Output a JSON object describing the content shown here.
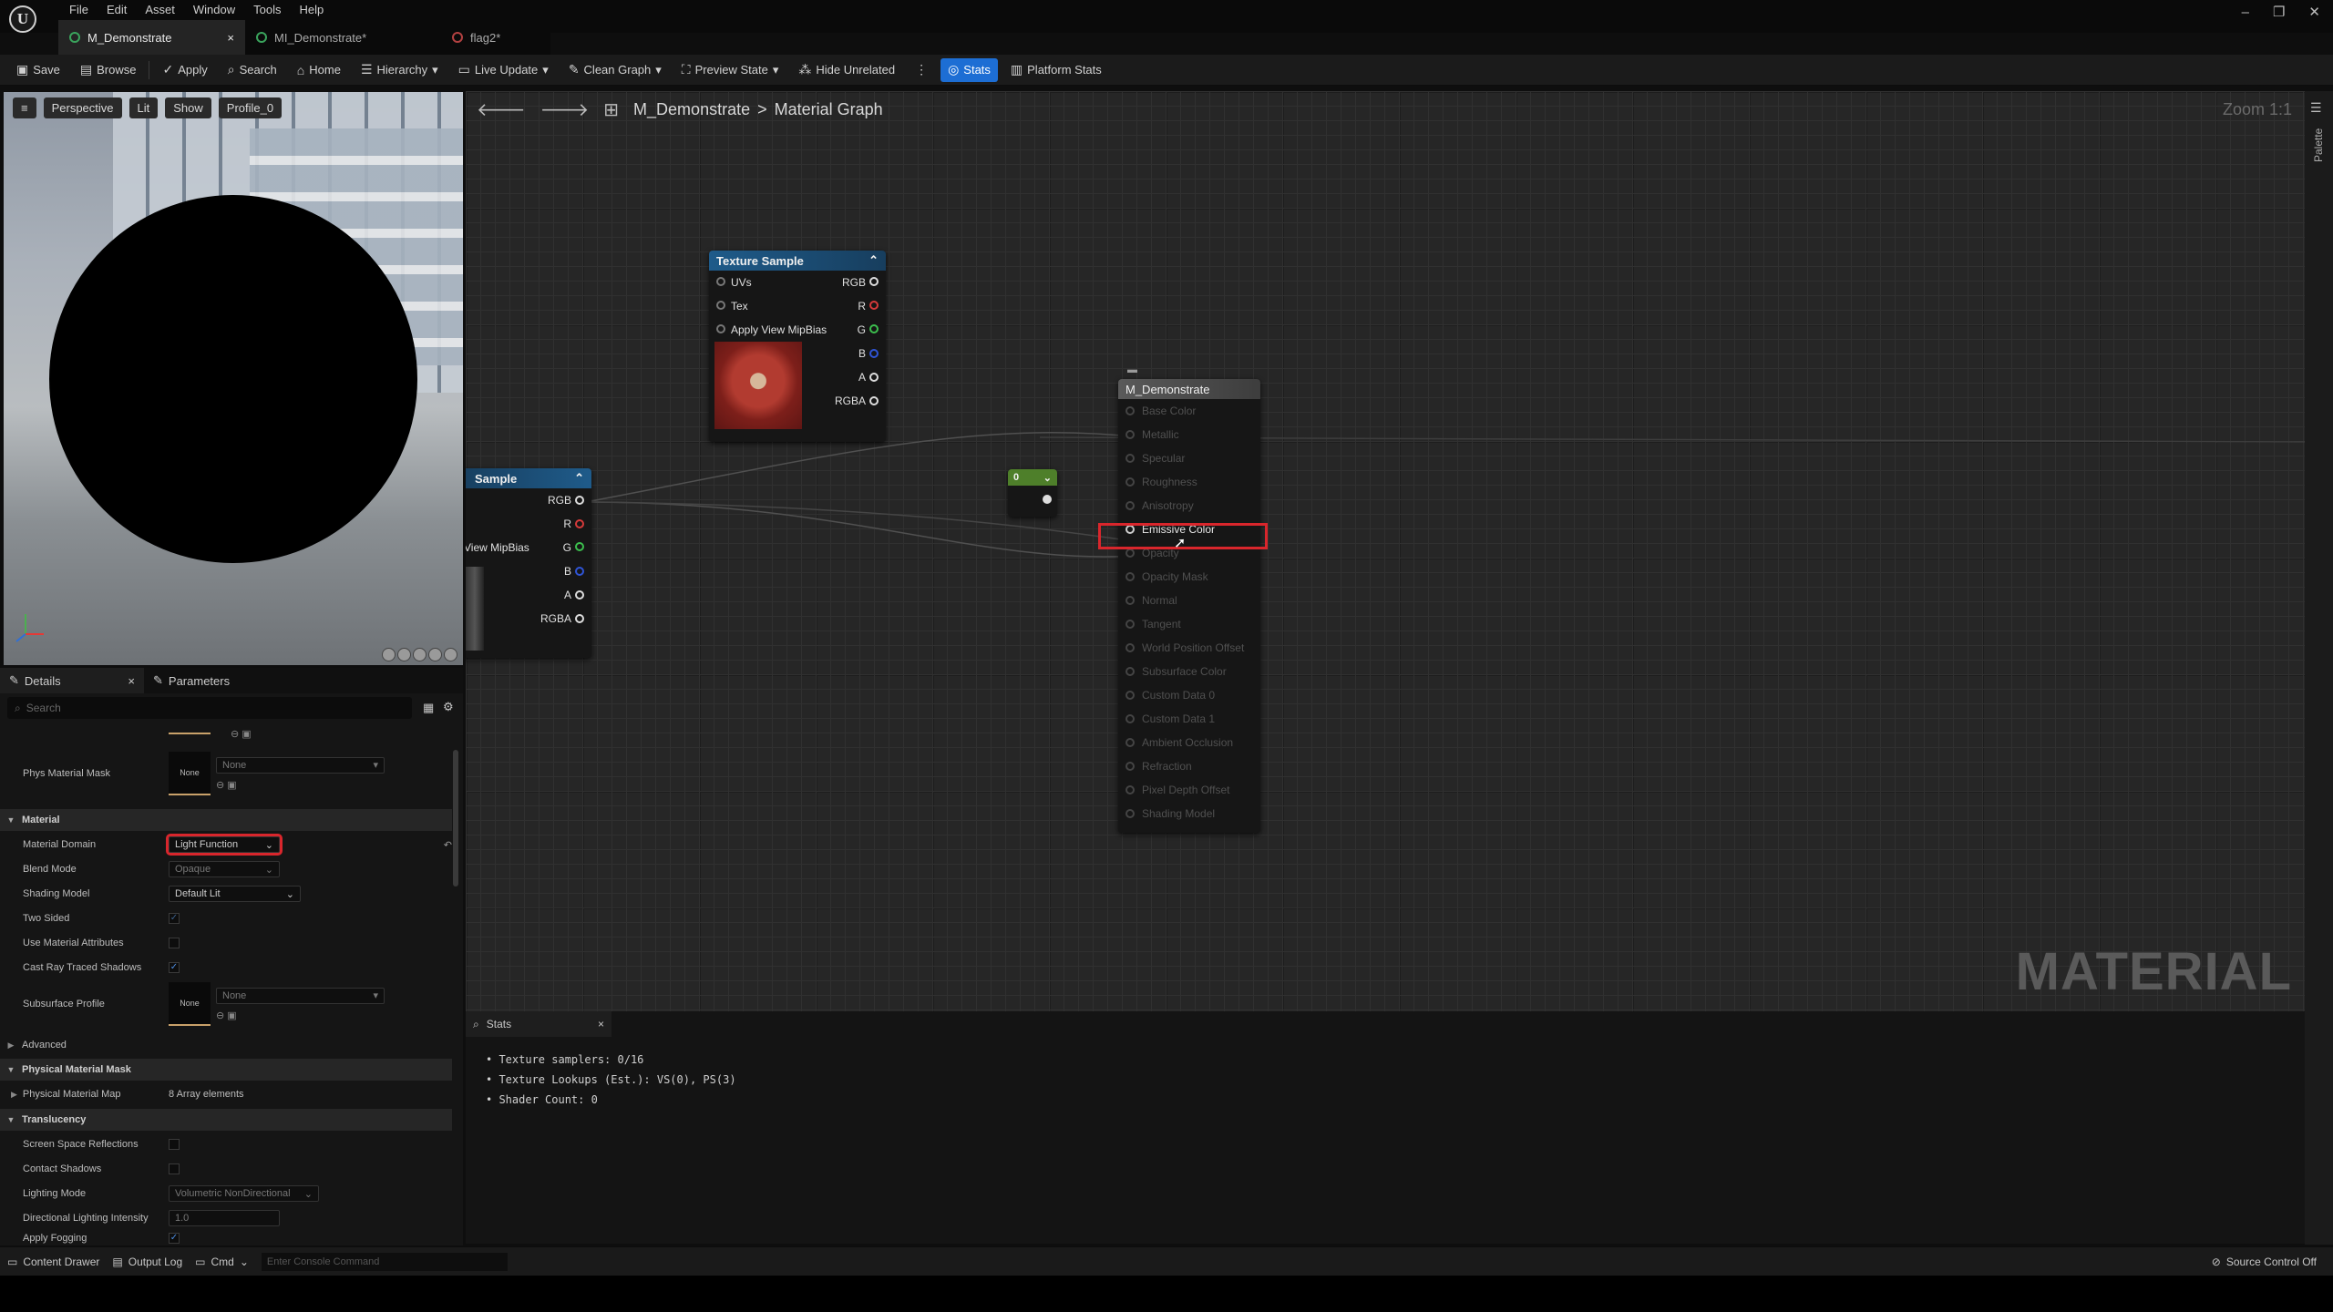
{
  "app": {
    "menu": [
      "File",
      "Edit",
      "Asset",
      "Window",
      "Tools",
      "Help"
    ],
    "window_controls": [
      "–",
      "❐",
      "✕"
    ]
  },
  "tabs": [
    {
      "label": "M_Demonstrate",
      "close": "×"
    },
    {
      "label": "MI_Demonstrate*"
    },
    {
      "label": "flag2*"
    }
  ],
  "toolbar": {
    "save": "Save",
    "browse": "Browse",
    "apply": "Apply",
    "search": "Search",
    "home": "Home",
    "hierarchy": "Hierarchy",
    "live_update": "Live Update",
    "clean_graph": "Clean Graph",
    "preview_state": "Preview State",
    "hide_unrelated": "Hide Unrelated",
    "stats": "Stats",
    "platform_stats": "Platform Stats"
  },
  "viewport": {
    "perspective": "Perspective",
    "lit": "Lit",
    "show": "Show",
    "profile": "Profile_0"
  },
  "details": {
    "tab_details": "Details",
    "tab_close": "×",
    "tab_parameters": "Parameters",
    "search_placeholder": "Search",
    "phys_material_mask": {
      "label": "Phys Material Mask",
      "thumb": "None",
      "value": "None"
    },
    "cat_material": "Material",
    "material_domain": {
      "label": "Material Domain",
      "value": "Light Function"
    },
    "blend_mode": {
      "label": "Blend Mode",
      "value": "Opaque"
    },
    "shading_model": {
      "label": "Shading Model",
      "value": "Default Lit"
    },
    "two_sided": "Two Sided",
    "use_material_attributes": "Use Material Attributes",
    "cast_ray_traced_shadows": "Cast Ray Traced Shadows",
    "subsurface_profile": {
      "label": "Subsurface Profile",
      "thumb": "None",
      "value": "None"
    },
    "advanced": "Advanced",
    "cat_physical_material_mask": "Physical Material Mask",
    "physical_material_map": {
      "label": "Physical Material Map",
      "value": "8 Array elements"
    },
    "cat_translucency": "Translucency",
    "screen_space_reflections": "Screen Space Reflections",
    "contact_shadows": "Contact Shadows",
    "lighting_mode": {
      "label": "Lighting Mode",
      "value": "Volumetric NonDirectional"
    },
    "directional_lighting_intensity": {
      "label": "Directional Lighting Intensity",
      "value": "1.0"
    },
    "apply_fogging": "Apply Fogging"
  },
  "graph": {
    "breadcrumb_root": "M_Demonstrate",
    "breadcrumb_sep": ">",
    "breadcrumb_leaf": "Material Graph",
    "zoom": "Zoom 1:1",
    "watermark": "MATERIAL",
    "palette": "Palette",
    "texture_sample_1": {
      "title": "Texture Sample",
      "inputs": [
        "UVs",
        "Tex",
        "Apply View MipBias"
      ],
      "outputs": [
        "RGB",
        "R",
        "G",
        "B",
        "A",
        "RGBA"
      ]
    },
    "texture_sample_2": {
      "title": "Sample",
      "inputs": [
        "View MipBias"
      ],
      "outputs": [
        "RGB",
        "R",
        "G",
        "B",
        "A",
        "RGBA"
      ]
    },
    "constant_node": {
      "value": "0"
    },
    "result_node": {
      "title": "M_Demonstrate",
      "pins": [
        "Base Color",
        "Metallic",
        "Specular",
        "Roughness",
        "Anisotropy",
        "Emissive Color",
        "Opacity",
        "Opacity Mask",
        "Normal",
        "Tangent",
        "World Position Offset",
        "Subsurface Color",
        "Custom Data 0",
        "Custom Data 1",
        "Ambient Occlusion",
        "Refraction",
        "Pixel Depth Offset",
        "Shading Model"
      ]
    }
  },
  "stats": {
    "tab": "Stats",
    "close": "×",
    "lines": [
      "Texture samplers: 0/16",
      "Texture Lookups (Est.): VS(0), PS(3)",
      "Shader Count: 0"
    ]
  },
  "statusbar": {
    "content_drawer": "Content Drawer",
    "output_log": "Output Log",
    "cmd": "Cmd",
    "console_placeholder": "Enter Console Command",
    "source_control": "Source Control Off"
  },
  "colors": {
    "accent": "#1d6ed4",
    "highlight": "#d9262c",
    "texture_header": "#1f5b8a"
  }
}
